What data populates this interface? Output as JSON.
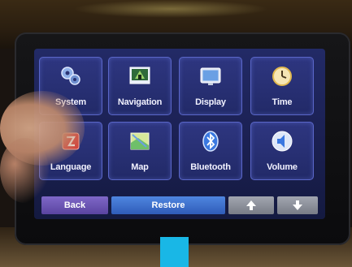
{
  "menu": {
    "tiles": [
      {
        "label": "System",
        "icon": "system-gears-icon"
      },
      {
        "label": "Navigation",
        "icon": "navigation-icon"
      },
      {
        "label": "Display",
        "icon": "display-icon"
      },
      {
        "label": "Time",
        "icon": "clock-icon"
      },
      {
        "label": "Language",
        "icon": "language-icon"
      },
      {
        "label": "Map",
        "icon": "map-icon"
      },
      {
        "label": "Bluetooth",
        "icon": "bluetooth-icon"
      },
      {
        "label": "Volume",
        "icon": "volume-icon"
      }
    ]
  },
  "bottom_bar": {
    "back_label": "Back",
    "restore_label": "Restore",
    "up_icon": "arrow-up-icon",
    "down_icon": "arrow-down-icon"
  },
  "colors": {
    "screen_bg": "#1b2052",
    "tile_border": "#5a66c8",
    "back_button": "#6a54b4",
    "restore_button": "#3a6fd0",
    "arrow_button": "#8a8e98",
    "marker": "#19b7e6"
  }
}
